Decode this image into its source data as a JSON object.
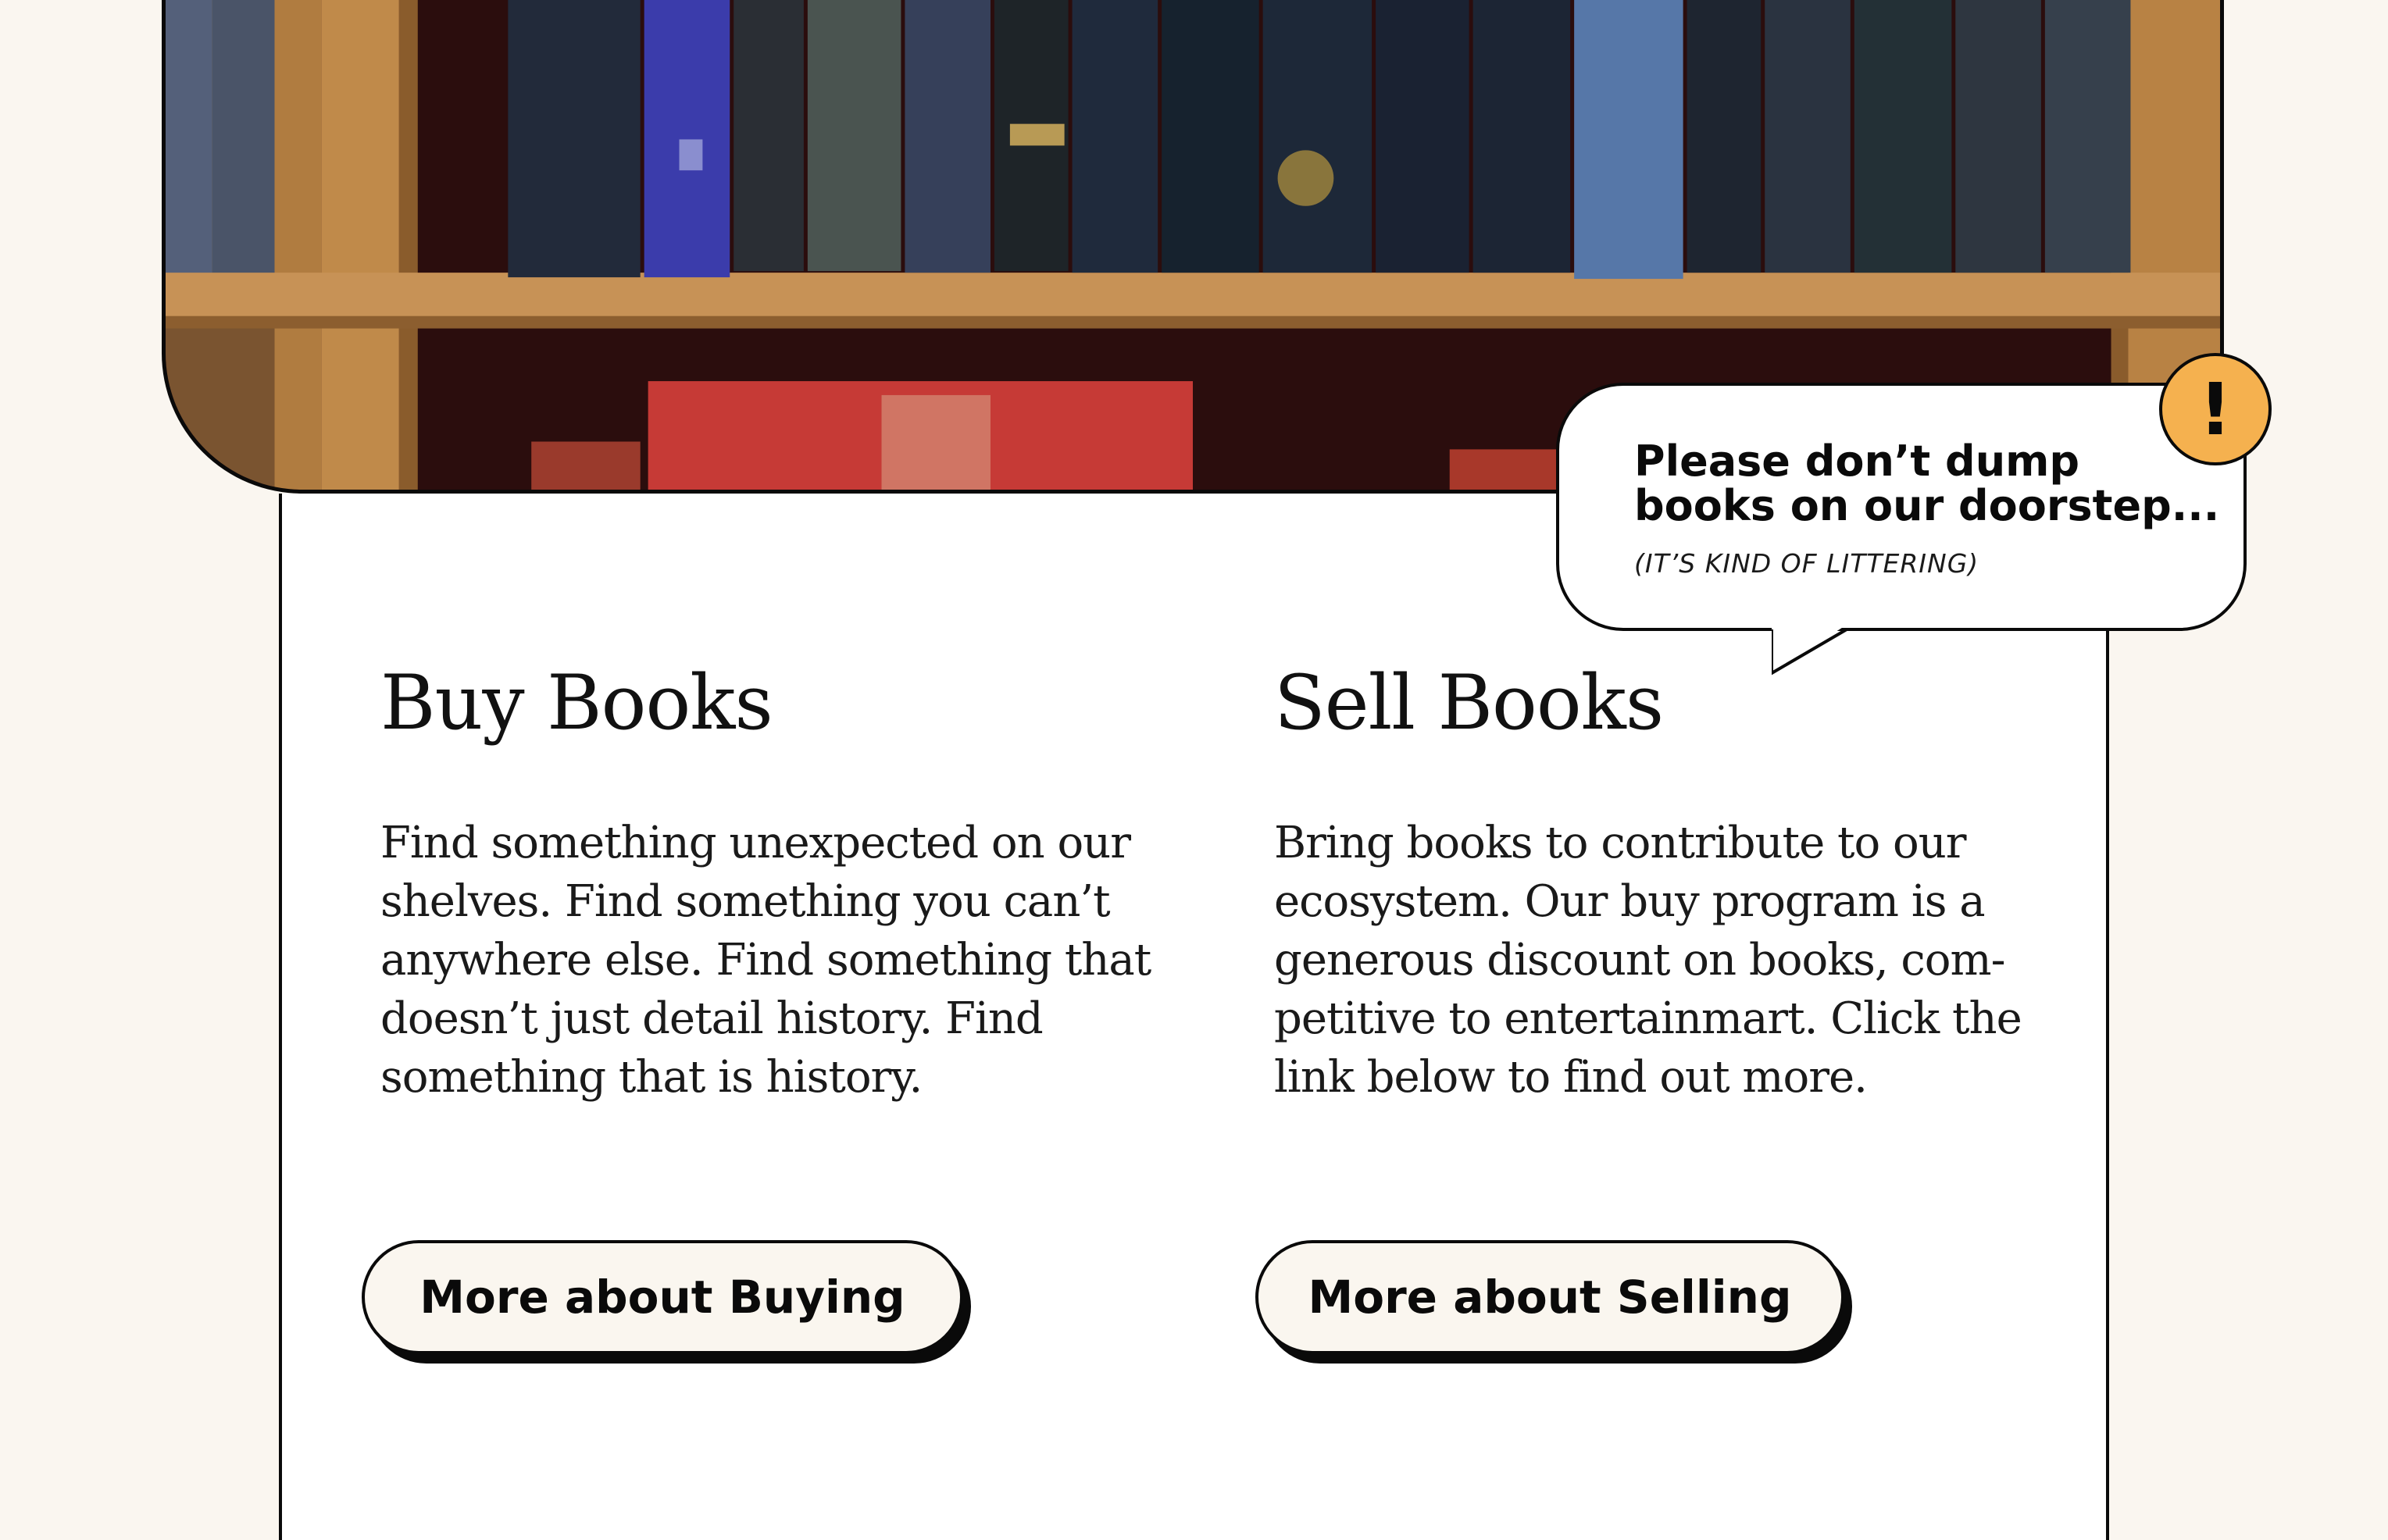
{
  "hero": {
    "image_name": "bookshelf-photo"
  },
  "buy": {
    "heading": "Buy Books",
    "body": "Find something unexpected on our shelves. Find something you can’t anywhere else. Find something that doesn’t just detail history. Find something that is history.",
    "button_label": "More about Buying"
  },
  "sell": {
    "heading": "Sell Books",
    "body": "Bring books to contribute to our ecosystem. Our buy program is a generous discount on books, com-petitive to entertainmart. Click the link below to find out more.",
    "button_label": "More about Selling"
  },
  "notice": {
    "title": "Please don’t dump books on our doorstep...",
    "note": "(IT’S KIND OF LITTERING)",
    "badge_icon": "exclamation-icon",
    "badge_glyph": "!",
    "badge_color": "#f5b14f"
  },
  "colors": {
    "page_background": "#faf6f0",
    "card_background": "#ffffff",
    "outline": "#0a0a0a",
    "button_background": "#faf6ef"
  }
}
